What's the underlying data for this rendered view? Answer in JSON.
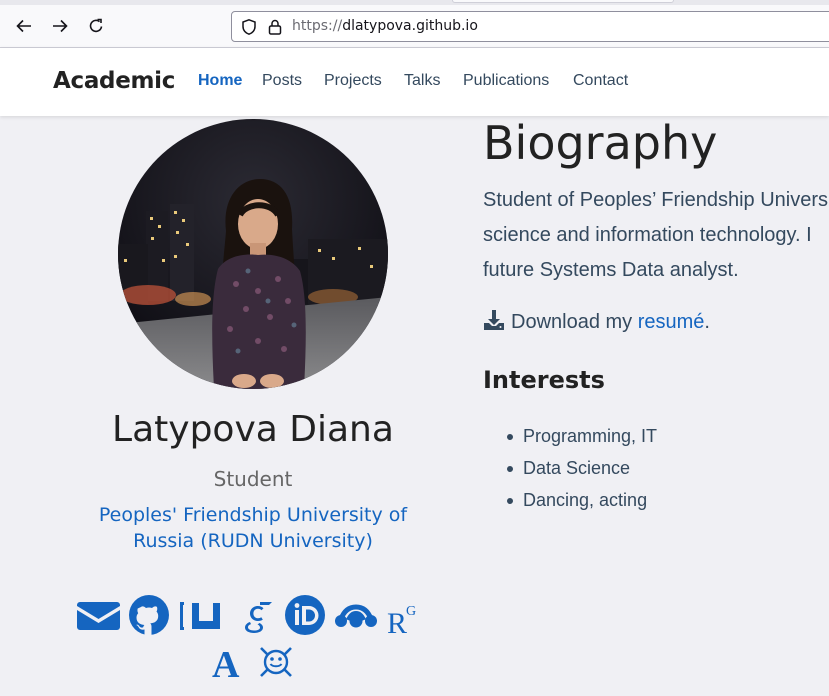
{
  "browser": {
    "url_protocol": "https://",
    "url_host": "dlatypova.github.io"
  },
  "navbar": {
    "brand": "Academic",
    "links": [
      "Home",
      "Posts",
      "Projects",
      "Talks",
      "Publications",
      "Contact"
    ],
    "active": "Home"
  },
  "profile": {
    "name": "Latypova Diana",
    "role": "Student",
    "organization": "Peoples' Friendship University of Russia (RUDN University)",
    "social_icons": [
      "envelope-icon",
      "github-icon",
      "arxiv-icon",
      "google-scholar-icon",
      "orcid-icon",
      "mendeley-icon",
      "researchgate-icon",
      "academia-icon",
      "zotero-icon"
    ]
  },
  "biography": {
    "heading": "Biography",
    "lines": [
      "Student of Peoples’ Friendship University of Russia,",
      "science and information technology. I",
      "future Systems Data analyst."
    ],
    "download_prefix": "Download my ",
    "download_link": "resumé",
    "download_suffix": "."
  },
  "interests": {
    "heading": "Interests",
    "items": [
      "Programming, IT",
      "Data Science",
      "Dancing, acting"
    ]
  },
  "colors": {
    "accent": "#1565c0",
    "text": "#34495e",
    "heading": "#222222",
    "background": "#f0f0f4"
  }
}
